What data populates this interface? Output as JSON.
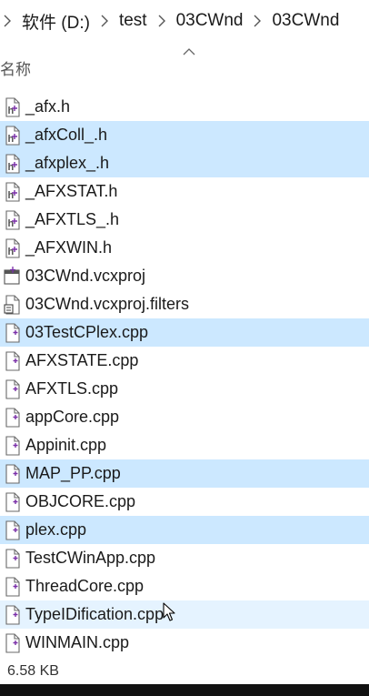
{
  "breadcrumb": {
    "items": [
      "软件 (D:)",
      "test",
      "03CWnd",
      "03CWnd"
    ]
  },
  "header": {
    "name_column": "名称"
  },
  "files": [
    {
      "name": "_afx.h",
      "type": "header",
      "state": "normal"
    },
    {
      "name": "_afxColl_.h",
      "type": "header",
      "state": "selected"
    },
    {
      "name": "_afxplex_.h",
      "type": "header",
      "state": "selected"
    },
    {
      "name": "_AFXSTAT.h",
      "type": "header",
      "state": "normal"
    },
    {
      "name": "_AFXTLS_.h",
      "type": "header",
      "state": "normal"
    },
    {
      "name": "_AFXWIN.h",
      "type": "header",
      "state": "normal"
    },
    {
      "name": "03CWnd.vcxproj",
      "type": "project",
      "state": "normal"
    },
    {
      "name": "03CWnd.vcxproj.filters",
      "type": "filters",
      "state": "normal"
    },
    {
      "name": "03TestCPlex.cpp",
      "type": "cpp",
      "state": "selected"
    },
    {
      "name": "AFXSTATE.cpp",
      "type": "cpp",
      "state": "normal"
    },
    {
      "name": "AFXTLS.cpp",
      "type": "cpp",
      "state": "normal"
    },
    {
      "name": "appCore.cpp",
      "type": "cpp",
      "state": "normal"
    },
    {
      "name": "Appinit.cpp",
      "type": "cpp",
      "state": "normal"
    },
    {
      "name": "MAP_PP.cpp",
      "type": "cpp",
      "state": "selected"
    },
    {
      "name": "OBJCORE.cpp",
      "type": "cpp",
      "state": "normal"
    },
    {
      "name": "plex.cpp",
      "type": "cpp",
      "state": "selected"
    },
    {
      "name": "TestCWinApp.cpp",
      "type": "cpp",
      "state": "normal"
    },
    {
      "name": "ThreadCore.cpp",
      "type": "cpp",
      "state": "normal"
    },
    {
      "name": "TypeIDification.cpp",
      "type": "cpp",
      "state": "hover"
    },
    {
      "name": "WINMAIN.cpp",
      "type": "cpp",
      "state": "normal"
    }
  ],
  "status": {
    "size": "6.58 KB"
  },
  "colors": {
    "selected": "#cce8ff",
    "hover": "#e5f3ff",
    "text": "#1a1a1a"
  }
}
